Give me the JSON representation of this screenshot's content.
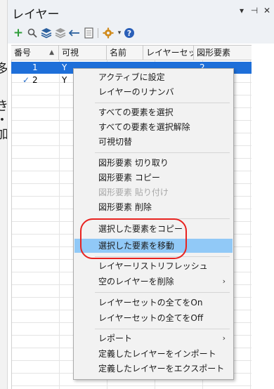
{
  "panel": {
    "title": "レイヤー",
    "controls": {
      "dropdown": "▾",
      "pin": "⊣",
      "close": "✕"
    }
  },
  "toolbar": {
    "icons": [
      "add-icon",
      "search-icon",
      "layers-blue-icon",
      "layers-gray-icon",
      "undo-arrow-icon",
      "document-icon",
      "gear-icon",
      "help-icon"
    ],
    "caret": "▾"
  },
  "table": {
    "columns": [
      "番号",
      "可視",
      "名前",
      "レイヤーセッ...",
      "図形要素"
    ],
    "sort_indicator": "▲",
    "rows": [
      {
        "number": "1",
        "visible": "Y",
        "name": "",
        "layer_set": "",
        "elements": "2",
        "selected": true,
        "checked": false
      },
      {
        "number": "2",
        "visible": "Y",
        "name": "",
        "layer_set": "",
        "elements": "",
        "selected": false,
        "checked": true
      }
    ],
    "check_mark": "✓"
  },
  "background_glyphs": [
    "多",
    "き",
    "・",
    "加"
  ],
  "context_menu": {
    "groups": [
      [
        {
          "label": "アクティブに設定"
        },
        {
          "label": "レイヤーのリナンバ"
        }
      ],
      [
        {
          "label": "すべての要素を選択"
        },
        {
          "label": "すべての要素を選択解除"
        },
        {
          "label": "可視切替"
        }
      ],
      [
        {
          "label": "図形要素 切り取り"
        },
        {
          "label": "図形要素 コピー"
        },
        {
          "label": "図形要素 貼り付け",
          "disabled": true
        },
        {
          "label": "図形要素 削除"
        }
      ],
      [
        {
          "label": "選択した要素をコピー"
        },
        {
          "label": "選択した要素を移動",
          "highlighted": true
        }
      ],
      [
        {
          "label": "レイヤーリストリフレッシュ"
        },
        {
          "label": "空のレイヤーを削除",
          "submenu": true
        }
      ],
      [
        {
          "label": "レイヤーセットの全てをOn"
        },
        {
          "label": "レイヤーセットの全てをOff"
        }
      ],
      [
        {
          "label": "レポート",
          "submenu": true
        },
        {
          "label": "定義したレイヤーをインポート"
        },
        {
          "label": "定義したレイヤーをエクスポート"
        }
      ]
    ],
    "submenu_arrow": "›"
  },
  "colors": {
    "selection": "#1e6fd9",
    "menu_highlight": "#91c9f7",
    "annotation_ring": "#e8221f"
  }
}
